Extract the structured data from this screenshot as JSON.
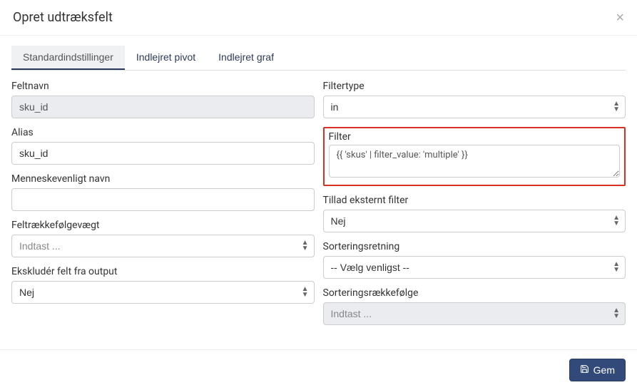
{
  "header": {
    "title": "Opret udtræksfelt",
    "close": "×"
  },
  "tabs": {
    "standard": "Standardindstillinger",
    "pivot": "Indlejret pivot",
    "graph": "Indlejret graf"
  },
  "left": {
    "fieldname": {
      "label": "Feltnavn",
      "value": "sku_id"
    },
    "alias": {
      "label": "Alias",
      "value": "sku_id"
    },
    "humanname": {
      "label": "Menneskevenligt navn",
      "value": ""
    },
    "orderweight": {
      "label": "Feltrækkefølgevægt",
      "placeholder": "Indtast ..."
    },
    "exclude": {
      "label": "Ekskludér felt fra output",
      "value": "Nej"
    }
  },
  "right": {
    "filtertype": {
      "label": "Filtertype",
      "value": "in"
    },
    "filter": {
      "label": "Filter",
      "value": "{{ 'skus' | filter_value: 'multiple' }}"
    },
    "external": {
      "label": "Tillad eksternt filter",
      "value": "Nej"
    },
    "sortdir": {
      "label": "Sorteringsretning",
      "value": "-- Vælg venligst --"
    },
    "sortorder": {
      "label": "Sorteringsrækkefølge",
      "placeholder": "Indtast ..."
    }
  },
  "footer": {
    "save": "Gem"
  }
}
